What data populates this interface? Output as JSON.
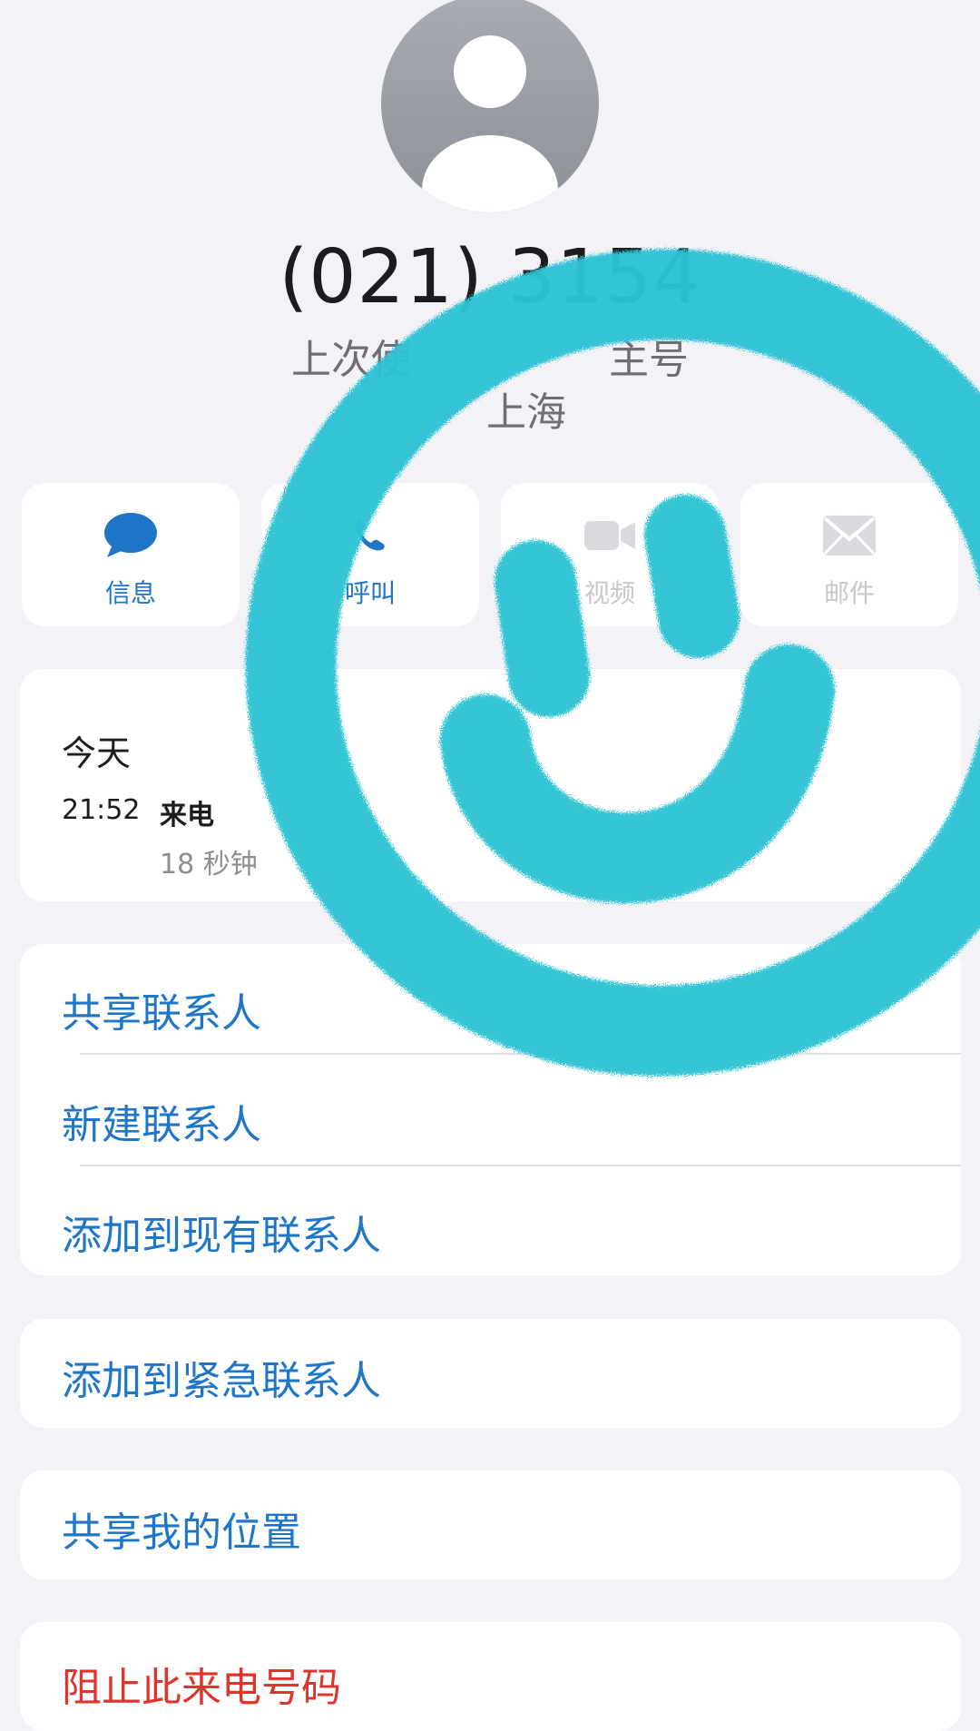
{
  "contact": {
    "phone_number": "(021) 3154",
    "last_used_label": "上次使",
    "last_used_value": "主号",
    "location": "上海"
  },
  "actions": [
    {
      "label": "信息",
      "icon": "message-bubble-icon",
      "color": "#1F76C9"
    },
    {
      "label": "呼叫",
      "icon": "phone-icon",
      "color": "#1F76C9"
    },
    {
      "label": "视频",
      "icon": "video-camera-icon",
      "color": "#C7C7CC"
    },
    {
      "label": "邮件",
      "icon": "envelope-icon",
      "color": "#C7C7CC"
    }
  ],
  "history": {
    "day": "今天",
    "time": "21:52",
    "type": "来电",
    "duration": "18 秒钟"
  },
  "contact_actions": [
    "共享联系人",
    "新建联系人",
    "添加到现有联系人"
  ],
  "emergency_action": "添加到紧急联系人",
  "location_action": "共享我的位置",
  "block_action": "阻止此来电号码",
  "colors": {
    "accent": "#1F76C9",
    "destructive": "#E0332B",
    "sticker": "#2EC3D4"
  }
}
